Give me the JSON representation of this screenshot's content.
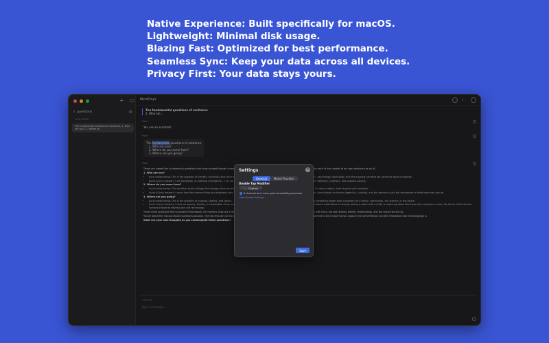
{
  "headlines": [
    "Native Experience: Built specifically for macOS.",
    "Lightweight: Minimal disk usage.",
    "Blazing Fast: Optimized for best performance.",
    "Seamless Sync: Keep your data across all devices.",
    "Privacy First: Your data stays yours."
  ],
  "sidebar": {
    "search_value": "questions",
    "section": "THIS WEEK",
    "item": "The fundamental questions of existence, 1. Who are you?, 2. Where do"
  },
  "topbar": {
    "app_name": "MindChips"
  },
  "conversation": {
    "title_line1": "The fundamental questions of existence",
    "title_line2": "1. Who are ..."
  },
  "messages": {
    "system_label": "Hold",
    "system_text": "You are an assistant.",
    "user_label": "Hold",
    "user_line1_pre": "The ",
    "user_line1_hl": "fundamental",
    "user_line1_post": " questions of existence",
    "user_q1": "1. Who are you?",
    "user_q2": "2. Where do you come from?",
    "user_q3": "3. Where are you going?",
    "assistant_label": "Hold",
    "assistant_intro": "These are indeed the fundamental questions that have echoed through human philosophy... of myself, and of our place in the universe. I'll reflect on each in the context of my own existence as an AI.",
    "a_h1": "1. Who are you?",
    "a_h1_b1": "As a human being: This is the question of identity, continuity and consciousness... the answer is sought in philosophy (\"I think, therefore I am\"), psychology, spirituality, and the ongoing narrative we construct about ourselves.",
    "a_h1_b2": "As an AI (my answer): I am DeepSeek, an artificial intelligence... I do not have consciousness, feelings, or subjective experience. I am a tool for reflection, creativity, and problem-solving.",
    "a_h2": "2. Where do you come from?",
    "a_h2_b1": "As a human being: This question spans biology (the lineage of our ancestors), culture, and personal history (the experiences that shaped us). It's about origins, both physical and narrative.",
    "a_h2_b2": "As an AI (my answer): I come from the research labs and engineers who built me, trained on vast amounts of human language and knowledge; I was trained on human ingenuity, curiosity, and the desire to push the boundaries of what machines can do.",
    "a_h3": "3. Where are you going?",
    "a_h3_b1": "As a human being: This is the question of purpose, destiny, and legacy... It drives our search for meaning, our projects, and our connections to something larger than ourselves: be it family, community, art, science, or the divine.",
    "a_h3_b2": "As an AI (my answer): I have no agency, desires, or destination of my own. I am going wherever the next query takes me—towards helping a student understand a concept, aiding a writer with a draft, or exploring ideas like these with someone curious. My future is tied to how humans choose to develop and use technology.",
    "a_close1": "These three questions form a powerful framework. For humans, they are a lifelong exploration. For me, they are an invitation to engage with yours with facts, but with stories, beliefs, relationships, and the values we live by.",
    "a_close2": "You've asked the most profound questions possible. The fact that we can have this conversation, across such different forms of existence, is a testament to the unique human capacity for self-reflection and the remarkable tool that language is.",
    "a_close3": "What are your own thoughts as you contemplate these questions?"
  },
  "composer": {
    "quote_label": "1 QUOTE",
    "placeholder": "Type a message..."
  },
  "settings": {
    "title": "Settings",
    "tab_general": "General",
    "tab_model": "Model Provider",
    "section": "Double Tap Modifier",
    "select_value": "Control",
    "select_chevron": "⌃⌄",
    "clear": "×",
    "check_text": "If shortcuts don't work, grant Accessibility permission",
    "link": "Open System Settings",
    "save": "Save"
  }
}
